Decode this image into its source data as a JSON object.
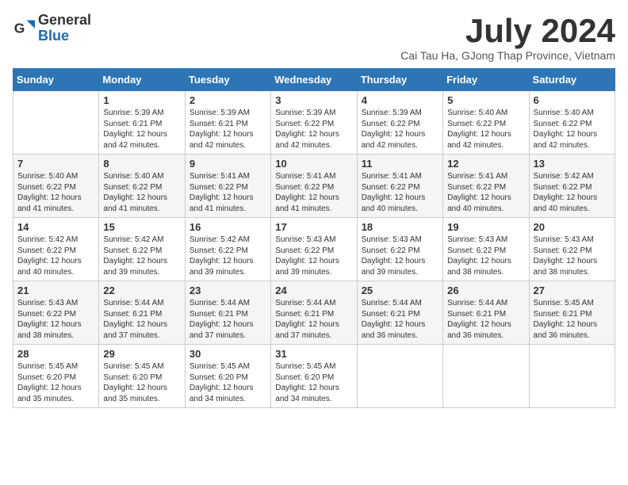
{
  "logo": {
    "general": "General",
    "blue": "Blue"
  },
  "title": "July 2024",
  "subtitle": "Cai Tau Ha, GJong Thap Province, Vietnam",
  "days_of_week": [
    "Sunday",
    "Monday",
    "Tuesday",
    "Wednesday",
    "Thursday",
    "Friday",
    "Saturday"
  ],
  "weeks": [
    [
      {
        "day": "",
        "content": ""
      },
      {
        "day": "1",
        "content": "Sunrise: 5:39 AM\nSunset: 6:21 PM\nDaylight: 12 hours and 42 minutes."
      },
      {
        "day": "2",
        "content": "Sunrise: 5:39 AM\nSunset: 6:21 PM\nDaylight: 12 hours and 42 minutes."
      },
      {
        "day": "3",
        "content": "Sunrise: 5:39 AM\nSunset: 6:22 PM\nDaylight: 12 hours and 42 minutes."
      },
      {
        "day": "4",
        "content": "Sunrise: 5:39 AM\nSunset: 6:22 PM\nDaylight: 12 hours and 42 minutes."
      },
      {
        "day": "5",
        "content": "Sunrise: 5:40 AM\nSunset: 6:22 PM\nDaylight: 12 hours and 42 minutes."
      },
      {
        "day": "6",
        "content": "Sunrise: 5:40 AM\nSunset: 6:22 PM\nDaylight: 12 hours and 42 minutes."
      }
    ],
    [
      {
        "day": "7",
        "content": "Sunrise: 5:40 AM\nSunset: 6:22 PM\nDaylight: 12 hours and 41 minutes."
      },
      {
        "day": "8",
        "content": "Sunrise: 5:40 AM\nSunset: 6:22 PM\nDaylight: 12 hours and 41 minutes."
      },
      {
        "day": "9",
        "content": "Sunrise: 5:41 AM\nSunset: 6:22 PM\nDaylight: 12 hours and 41 minutes."
      },
      {
        "day": "10",
        "content": "Sunrise: 5:41 AM\nSunset: 6:22 PM\nDaylight: 12 hours and 41 minutes."
      },
      {
        "day": "11",
        "content": "Sunrise: 5:41 AM\nSunset: 6:22 PM\nDaylight: 12 hours and 40 minutes."
      },
      {
        "day": "12",
        "content": "Sunrise: 5:41 AM\nSunset: 6:22 PM\nDaylight: 12 hours and 40 minutes."
      },
      {
        "day": "13",
        "content": "Sunrise: 5:42 AM\nSunset: 6:22 PM\nDaylight: 12 hours and 40 minutes."
      }
    ],
    [
      {
        "day": "14",
        "content": "Sunrise: 5:42 AM\nSunset: 6:22 PM\nDaylight: 12 hours and 40 minutes."
      },
      {
        "day": "15",
        "content": "Sunrise: 5:42 AM\nSunset: 6:22 PM\nDaylight: 12 hours and 39 minutes."
      },
      {
        "day": "16",
        "content": "Sunrise: 5:42 AM\nSunset: 6:22 PM\nDaylight: 12 hours and 39 minutes."
      },
      {
        "day": "17",
        "content": "Sunrise: 5:43 AM\nSunset: 6:22 PM\nDaylight: 12 hours and 39 minutes."
      },
      {
        "day": "18",
        "content": "Sunrise: 5:43 AM\nSunset: 6:22 PM\nDaylight: 12 hours and 39 minutes."
      },
      {
        "day": "19",
        "content": "Sunrise: 5:43 AM\nSunset: 6:22 PM\nDaylight: 12 hours and 38 minutes."
      },
      {
        "day": "20",
        "content": "Sunrise: 5:43 AM\nSunset: 6:22 PM\nDaylight: 12 hours and 38 minutes."
      }
    ],
    [
      {
        "day": "21",
        "content": "Sunrise: 5:43 AM\nSunset: 6:22 PM\nDaylight: 12 hours and 38 minutes."
      },
      {
        "day": "22",
        "content": "Sunrise: 5:44 AM\nSunset: 6:21 PM\nDaylight: 12 hours and 37 minutes."
      },
      {
        "day": "23",
        "content": "Sunrise: 5:44 AM\nSunset: 6:21 PM\nDaylight: 12 hours and 37 minutes."
      },
      {
        "day": "24",
        "content": "Sunrise: 5:44 AM\nSunset: 6:21 PM\nDaylight: 12 hours and 37 minutes."
      },
      {
        "day": "25",
        "content": "Sunrise: 5:44 AM\nSunset: 6:21 PM\nDaylight: 12 hours and 36 minutes."
      },
      {
        "day": "26",
        "content": "Sunrise: 5:44 AM\nSunset: 6:21 PM\nDaylight: 12 hours and 36 minutes."
      },
      {
        "day": "27",
        "content": "Sunrise: 5:45 AM\nSunset: 6:21 PM\nDaylight: 12 hours and 36 minutes."
      }
    ],
    [
      {
        "day": "28",
        "content": "Sunrise: 5:45 AM\nSunset: 6:20 PM\nDaylight: 12 hours and 35 minutes."
      },
      {
        "day": "29",
        "content": "Sunrise: 5:45 AM\nSunset: 6:20 PM\nDaylight: 12 hours and 35 minutes."
      },
      {
        "day": "30",
        "content": "Sunrise: 5:45 AM\nSunset: 6:20 PM\nDaylight: 12 hours and 34 minutes."
      },
      {
        "day": "31",
        "content": "Sunrise: 5:45 AM\nSunset: 6:20 PM\nDaylight: 12 hours and 34 minutes."
      },
      {
        "day": "",
        "content": ""
      },
      {
        "day": "",
        "content": ""
      },
      {
        "day": "",
        "content": ""
      }
    ]
  ]
}
